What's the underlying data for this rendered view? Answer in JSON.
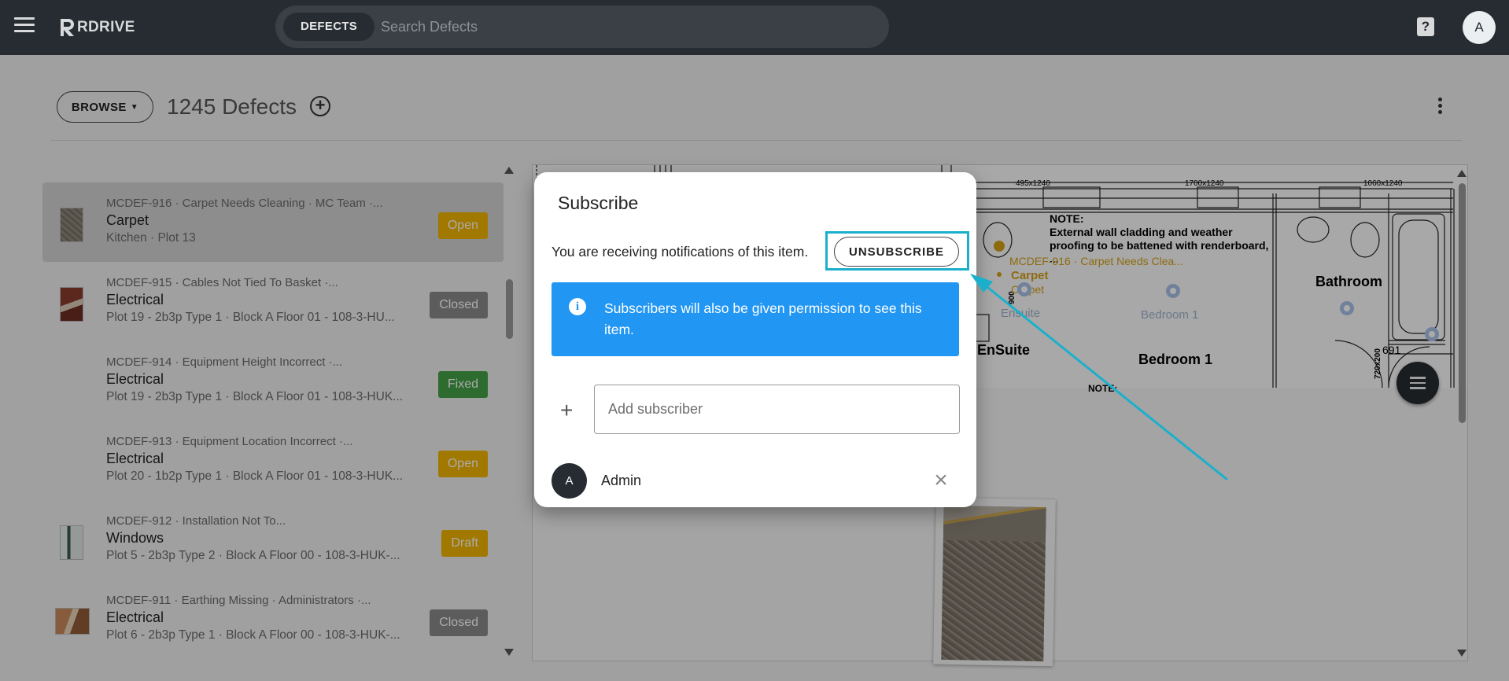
{
  "topbar": {
    "brand": "RDRIVE",
    "search_chip": "DEFECTS",
    "search_placeholder": "Search Defects",
    "help_icon": "question-icon",
    "avatar_initial": "A"
  },
  "header": {
    "browse_label": "BROWSE",
    "count_label": "1245 Defects"
  },
  "defects": [
    {
      "code": "MCDEF-916 · Carpet Needs Cleaning · MC Team ·...",
      "category": "Carpet",
      "location": "Kitchen · Plot 13",
      "status": "Open",
      "status_color": "#f0b400"
    },
    {
      "code": "MCDEF-915 · Cables Not Tied To Basket ·...",
      "category": "Electrical",
      "location": "Plot 19 - 2b3p Type 1 · Block A Floor 01 - 108-3-HU...",
      "status": "Closed",
      "status_color": "#8a8a8a"
    },
    {
      "code": "MCDEF-914 · Equipment Height Incorrect ·...",
      "category": "Electrical",
      "location": "Plot 19 - 2b3p Type 1 · Block A Floor 01 - 108-3-HUK...",
      "status": "Fixed",
      "status_color": "#43a047"
    },
    {
      "code": "MCDEF-913 · Equipment Location Incorrect ·...",
      "category": "Electrical",
      "location": "Plot 20 - 1b2p Type 1 · Block A Floor 01 - 108-3-HUK...",
      "status": "Open",
      "status_color": "#f0b400"
    },
    {
      "code": "MCDEF-912 · Installation Not To...",
      "category": "Windows",
      "location": "Plot 5 - 2b3p Type 2 · Block A Floor 00 - 108-3-HUK-...",
      "status": "Draft",
      "status_color": "#f0b400"
    },
    {
      "code": "MCDEF-911 · Earthing Missing · Administrators ·...",
      "category": "Electrical",
      "location": "Plot 6 - 2b3p Type 1 · Block A Floor 00 - 108-3-HUK-...",
      "status": "Closed",
      "status_color": "#8a8a8a"
    }
  ],
  "plan": {
    "dims": [
      "495x1240",
      "1700x1240",
      "1060x1240"
    ],
    "note_title": "NOTE:",
    "note_lines": [
      "External wall cladding and weather",
      "proofing to be battened with renderboard,"
    ],
    "note_tail": "...",
    "pin_label": "MCDEF-916 · Carpet Needs Clea...",
    "pin_category": "Carpet",
    "pin_sub": "Carpet",
    "room_ensuite": "EnSuite",
    "room_ensuite_faint": "Ensuite",
    "room_bedroom": "Bedroom 1",
    "room_bedroom_faint": "Bedroom 1",
    "room_bathroom": "Bathroom",
    "room_note_bottom": "NOTE:",
    "dim_900": "900",
    "dim_691": "691",
    "dim_720": "720x200"
  },
  "dialog": {
    "title": "Subscribe",
    "message": "You are receiving notifications of this item.",
    "unsubscribe_label": "UNSUBSCRIBE",
    "info_text": "Subscribers will also be given permission to see this item.",
    "add_placeholder": "Add subscriber",
    "subscriber_initial": "A",
    "subscriber_name": "Admin"
  },
  "colors": {
    "topbar": "#262c31",
    "info": "#2196f3",
    "annotation": "#1ab0cc",
    "pin": "#d4a017"
  }
}
